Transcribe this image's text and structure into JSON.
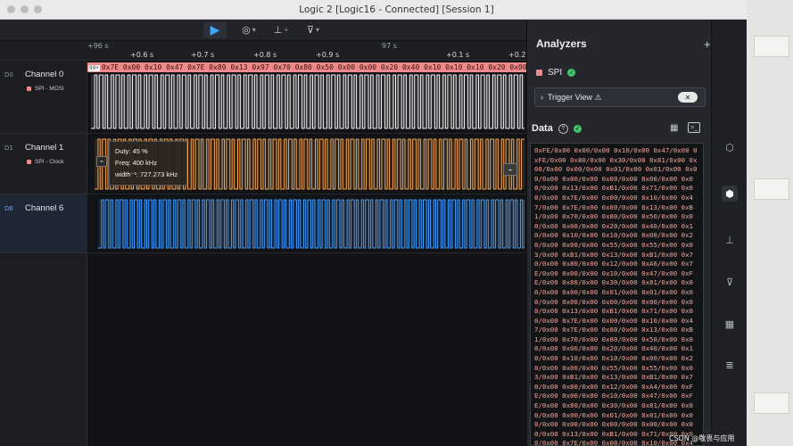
{
  "window": {
    "title": "Logic 2 [Logic16 - Connected] [Session 1]"
  },
  "toolbar": {
    "play_icon": "play-icon",
    "items": [
      {
        "name": "measure-icon",
        "glyph": "◎"
      },
      {
        "name": "annotation-icon",
        "glyph": "⊥"
      },
      {
        "name": "marker-icon",
        "glyph": "⊽"
      }
    ]
  },
  "ruler": {
    "origin": "+96 s",
    "center": "97 s",
    "ticks": [
      "+0.6 s",
      "+0.7 s",
      "+0.8 s",
      "+0.9 s",
      "+0.1 s",
      "+0.2"
    ]
  },
  "channels": [
    {
      "idx": "D0",
      "name": "Channel 0",
      "analyzer": "SPI - MOSI",
      "color": "#f0f0f0"
    },
    {
      "idx": "D1",
      "name": "Channel 1",
      "analyzer": "SPI - Clock",
      "color": "#f0a455"
    },
    {
      "idx": "D6",
      "name": "Channel 6",
      "analyzer": "",
      "color": "#3f9cff"
    }
  ],
  "decode": {
    "tag": "99+",
    "text": "0x7E 0x00 0x10 0x47 0x7E 0x80 0x13 0x97 0x70 0x80 0x50 0x00 0x00 0x20 0x40 0x10 0x10 0x10 0x20 0x00 0x55 0x55"
  },
  "measurement": {
    "duty": "Duty: 45 %",
    "freq": "Freq: 400 kHz",
    "width": "width⁻¹: 727.273 kHz"
  },
  "analyzers": {
    "header": "Analyzers",
    "add_label": "+",
    "spi_label": "SPI",
    "trigger_label": "Trigger View ⚠",
    "data_label": "Data",
    "terminal_text": "0xFE/0x00 0x00/0x00 0x10/0x00 0x47/0x00 0xFE/0x00 0x80/0x00 0x30/0x00 0x81/0x00 0x00/0x00 0x00/0x00 0x01/0x00 0x01/0x00 0x00/0x00 0x00/0x00 0x00/0x00 0x00/0x00 0x00/0x00 0x13/0x00 0xB1/0x00 0x71/0x00 0x00/0x00 0x7E/0x00 0x00/0x00 0x10/0x00 0x47/0x00 0x7E/0x00 0x80/0x00 0x13/0x00 0xB1/0x00 0x70/0x00 0x80/0x00 0x50/0x00 0x00/0x00 0x00/0x00 0x20/0x00 0x40/0x00 0x10/0x00 0x10/0x00 0x10/0x00 0x00/0x00 0x20/0x00 0x00/0x00 0x55/0x00 0x55/0x00 0x03/0x00 0xB1/0x00 0x13/0x00 0xB1/0x00 0x70/0x00 0x80/0x00 0x12/0x00 0xA6/0x00 0x7E/0x00 0x00/0x00 0x10/0x00 0x47/0x00 0xFE/0x00 0x80/0x00 0x30/0x00 0x81/0x00 0x00/0x00 0x00/0x00 0x01/0x00 0x01/0x00 0x00/0x00 0x00/0x00 0x00/0x00 0x00/0x00 0x00/0x00 0x13/0x00 0xB1/0x00 0x71/0x00 0x00/0x00 0x7E/0x00 0x00/0x00 0x10/0x00 0x47/0x00 0x7E/0x00 0x80/0x00 0x13/0x00 0xB1/0x00 0x70/0x00 0x80/0x00 0x50/0x00 0x00/0x00 0x00/0x00 0x20/0x00 0x40/0x00 0x10/0x00 0x10/0x00 0x10/0x00 0x00/0x00 0x20/0x00 0x00/0x00 0x55/0x00 0x55/0x00 0x03/0x00 0xB1/0x00 0x13/0x00 0xB1/0x00 0x70/0x00 0x80/0x00 0x12/0x00 0xA4/0x00 0xFE/0x00 0x00/0x00 0x10/0x00 0x47/0x00 0xFE/0x00 0x80/0x00 0x30/0x00 0x81/0x00 0x00/0x00 0x00/0x00 0x01/0x00 0x01/0x00 0x00/0x00 0x00/0x00 0x00/0x00 0x00/0x00 0x00/0x00 0x13/0x00 0xB1/0x00 0x71/0x00 0x00/0x00 0x7E/0x00 0x00/0x00 0x10/0x00 0x47/0x00 0x7E/0x00 0x80/0x00 0x13/0x00 0xB1/0x00"
  },
  "rail": [
    {
      "name": "analyzers-rail-icon",
      "glyph": "⬡"
    },
    {
      "name": "extensions-rail-icon",
      "glyph": "⬢"
    },
    {
      "name": "measurements-rail-icon",
      "glyph": "⊥"
    },
    {
      "name": "markers-rail-icon",
      "glyph": "⊽"
    },
    {
      "name": "layout-rail-icon",
      "glyph": "▦"
    },
    {
      "name": "notes-rail-icon",
      "glyph": "≣"
    }
  ],
  "watermark": "CSDN @敬畏与应用"
}
